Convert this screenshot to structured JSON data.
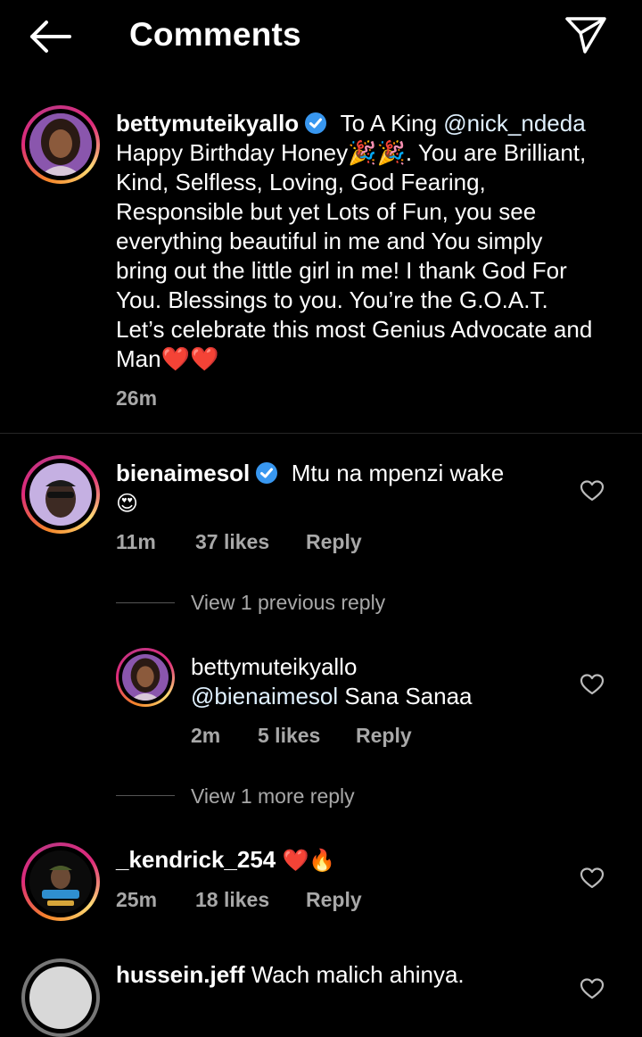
{
  "header": {
    "title": "Comments",
    "back_icon": "arrow-left-icon",
    "share_icon": "send-icon"
  },
  "caption": {
    "username": "bettymuteikyallo",
    "verified": true,
    "text_before_mention": "To A King",
    "mention": "@nick_ndeda",
    "text_after_mention": "Happy Birthday Honey🎉🎉. You are Brilliant, Kind, Selfless, Loving, God Fearing, Responsible but yet Lots of Fun, you see everything beautiful in me and You simply bring out the little girl in me! I thank God For You. Blessings to you. You’re the G.O.A.T. Let’s celebrate this most Genius Advocate and Man❤️❤️",
    "time": "26m"
  },
  "comments": [
    {
      "username": "bienaimesol",
      "verified": true,
      "text": "Mtu na mpenzi wake",
      "emoji": "😍",
      "time": "11m",
      "likes": "37 likes",
      "reply_label": "Reply",
      "view_replies_label": "View 1 previous reply",
      "reply": {
        "username": "bettymuteikyallo",
        "mention": "@bienaimesol",
        "text": "Sana Sanaa",
        "time": "2m",
        "likes": "5 likes",
        "reply_label": "Reply"
      },
      "view_more_label": "View 1 more reply"
    },
    {
      "username": "_kendrick_254",
      "emoji": "❤️🔥",
      "time": "25m",
      "likes": "18 likes",
      "reply_label": "Reply"
    },
    {
      "username": "hussein.jeff",
      "text": "Wach malich ahinya."
    }
  ],
  "colors": {
    "background": "#000000",
    "secondary_text": "#a8a8a8",
    "verified_blue": "#3897f0",
    "mention": "#e0f1ff"
  }
}
